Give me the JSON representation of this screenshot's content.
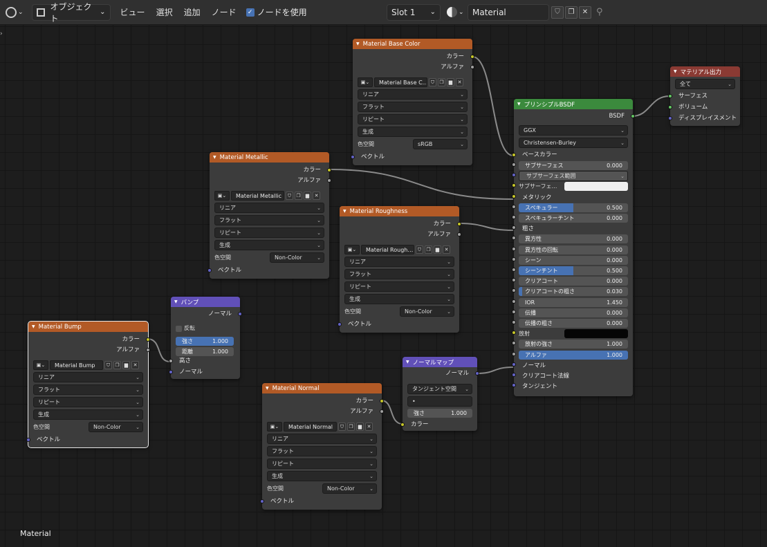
{
  "header": {
    "object_mode": "オブジェクト",
    "menus": [
      "ビュー",
      "選択",
      "追加",
      "ノード"
    ],
    "use_nodes": "ノードを使用",
    "slot": "Slot 1",
    "material_name": "Material"
  },
  "colors": {
    "texture_header": "#b25a26",
    "vector_header": "#6150b8",
    "shader_header": "#3b8a3d",
    "output_header": "#8a3a33",
    "color_socket": "#c7c729",
    "float_socket": "#a1a1a1",
    "vector_socket": "#6363c7",
    "shader_socket": "#63c763",
    "accent": "#4772b3"
  },
  "texnodes": [
    {
      "title": "Material Base Color",
      "image": "Material Base C…",
      "interp": "リニア",
      "proj": "フラット",
      "ext": "リピート",
      "source": "生成",
      "cs_label": "色空間",
      "colorspace": "sRGB",
      "out_color": "カラー",
      "out_alpha": "アルファ",
      "in_vector": "ベクトル"
    },
    {
      "title": "Material Metallic",
      "image": "Material Metallic",
      "interp": "リニア",
      "proj": "フラット",
      "ext": "リピート",
      "source": "生成",
      "cs_label": "色空間",
      "colorspace": "Non-Color",
      "out_color": "カラー",
      "out_alpha": "アルファ",
      "in_vector": "ベクトル"
    },
    {
      "title": "Material Roughness",
      "image": "Material Rough…",
      "interp": "リニア",
      "proj": "フラット",
      "ext": "リピート",
      "source": "生成",
      "cs_label": "色空間",
      "colorspace": "Non-Color",
      "out_color": "カラー",
      "out_alpha": "アルファ",
      "in_vector": "ベクトル"
    },
    {
      "title": "Material Bump",
      "image": "Material Bump",
      "interp": "リニア",
      "proj": "フラット",
      "ext": "リピート",
      "source": "生成",
      "cs_label": "色空間",
      "colorspace": "Non-Color",
      "out_color": "カラー",
      "out_alpha": "アルファ",
      "in_vector": "ベクトル"
    },
    {
      "title": "Material Normal",
      "image": "Material Normal",
      "interp": "リニア",
      "proj": "フラット",
      "ext": "リピート",
      "source": "生成",
      "cs_label": "色空間",
      "colorspace": "Non-Color",
      "out_color": "カラー",
      "out_alpha": "アルファ",
      "in_vector": "ベクトル"
    }
  ],
  "bump": {
    "title": "バンプ",
    "out_normal": "ノーマル",
    "invert": "反転",
    "strength_label": "強さ",
    "strength": "1.000",
    "distance_label": "距離",
    "distance": "1.000",
    "in_height": "高さ",
    "in_normal": "ノーマル"
  },
  "normalmap": {
    "title": "ノーマルマップ",
    "out_normal": "ノーマル",
    "space": "タンジェント空間",
    "uv": "•",
    "strength_label": "強さ",
    "strength": "1.000",
    "in_color": "カラー"
  },
  "bsdf": {
    "title": "プリンシプルBSDF",
    "out": "BSDF",
    "distribution": "GGX",
    "subsurface_method": "Christensen-Burley",
    "base_color": "ベースカラー",
    "fields": [
      {
        "label": "サブサーフェス",
        "value": "0.000",
        "fill": 0
      },
      {
        "label": "サブサーフェス範囲",
        "value": "",
        "fill": 0
      },
      {
        "label": "サブサーフェ…",
        "value": "",
        "fill": 0
      },
      {
        "label": "メタリック",
        "value": "",
        "fill": 0
      },
      {
        "label": "スペキュラー",
        "value": "0.500",
        "fill": 0.5
      },
      {
        "label": "スペキュラーチント",
        "value": "0.000",
        "fill": 0
      },
      {
        "label": "粗さ",
        "value": "",
        "fill": 0
      },
      {
        "label": "異方性",
        "value": "0.000",
        "fill": 0
      },
      {
        "label": "異方性の回転",
        "value": "0.000",
        "fill": 0
      },
      {
        "label": "シーン",
        "value": "0.000",
        "fill": 0
      },
      {
        "label": "シーンチント",
        "value": "0.500",
        "fill": 0.5
      },
      {
        "label": "クリアコート",
        "value": "0.000",
        "fill": 0
      },
      {
        "label": "クリアコートの粗さ",
        "value": "0.030",
        "fill": 0.03
      },
      {
        "label": "IOR",
        "value": "1.450",
        "fill": 0
      },
      {
        "label": "伝播",
        "value": "0.000",
        "fill": 0
      },
      {
        "label": "伝播の粗さ",
        "value": "0.000",
        "fill": 0
      },
      {
        "label": "放射",
        "value": "",
        "fill": 0
      },
      {
        "label": "放射の強さ",
        "value": "1.000",
        "fill": 0
      },
      {
        "label": "アルファ",
        "value": "1.000",
        "fill": 1
      },
      {
        "label": "ノーマル",
        "value": "",
        "fill": 0
      },
      {
        "label": "クリアコート法線",
        "value": "",
        "fill": 0
      },
      {
        "label": "タンジェント",
        "value": "",
        "fill": 0
      }
    ]
  },
  "output": {
    "title": "マテリアル出力",
    "target": "全て",
    "surface": "サーフェス",
    "volume": "ボリューム",
    "displacement": "ディスプレイスメント"
  },
  "footer_label": "Material"
}
